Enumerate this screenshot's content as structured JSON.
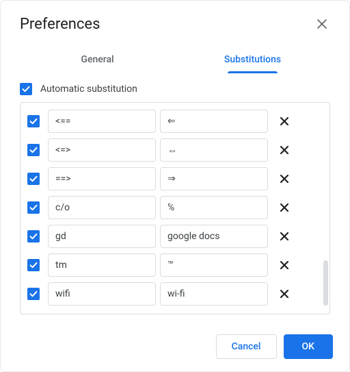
{
  "dialog": {
    "title": "Preferences",
    "tabs": {
      "general": "General",
      "substitutions": "Substitutions"
    },
    "auto_label": "Automatic substitution",
    "auto_checked": true,
    "rows": [
      {
        "checked": true,
        "replace": "<==",
        "with": "⇐"
      },
      {
        "checked": true,
        "replace": "<=>",
        "with": "⇔"
      },
      {
        "checked": true,
        "replace": "==>",
        "with": "⇒"
      },
      {
        "checked": true,
        "replace": "c/o",
        "with": "℅"
      },
      {
        "checked": true,
        "replace": "gd",
        "with": "google docs"
      },
      {
        "checked": true,
        "replace": "tm",
        "with": "™"
      },
      {
        "checked": true,
        "replace": "wifi",
        "with": "wi-fi"
      }
    ],
    "cancel": "Cancel",
    "ok": "OK"
  }
}
